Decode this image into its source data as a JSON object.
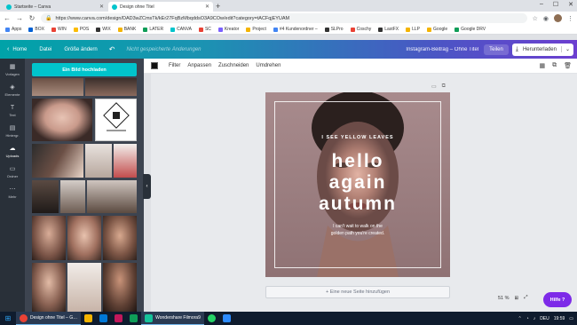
{
  "browser": {
    "tabs": [
      {
        "title": "Startseite – Canva",
        "active": false
      },
      {
        "title": "Design ohne Titel",
        "active": true
      }
    ],
    "new_tab": "+",
    "url": "https://www.canva.com/design/DAD3wZCmsTk/kEr27FqBzMbqddsO3A9COw/edit?category=tACFqjEYUAM",
    "bookmarks": [
      "Apps",
      "BOX",
      "WIN",
      "POS",
      "WIX",
      "BANK",
      "LATER",
      "CANVA",
      "SC",
      "Kreator",
      "Project",
      "#4 Kundenordner –",
      "SLPro",
      "Coschy",
      "LastFX",
      "LLP",
      "Google",
      "Google DRV"
    ]
  },
  "header": {
    "home": "Home",
    "file": "Datei",
    "resize": "Größe ändern",
    "undo_icon": "undo-icon",
    "unsaved": "Nicht gespeicherte Änderungen",
    "doc_title": "Instagram-Beitrag – Ohne Titel",
    "share": "Teilen",
    "download": "Herunterladen"
  },
  "rail": [
    {
      "label": "Vorlagen",
      "icon": "▦"
    },
    {
      "label": "Elemente",
      "icon": "◈"
    },
    {
      "label": "Text",
      "icon": "T"
    },
    {
      "label": "Hintergr.",
      "icon": "▤"
    },
    {
      "label": "Uploads",
      "icon": "☁"
    },
    {
      "label": "Ordner",
      "icon": "▭"
    },
    {
      "label": "Mehr",
      "icon": "⋯"
    }
  ],
  "panel": {
    "upload_button": "Ein Bild hochladen"
  },
  "toolbar": {
    "filter": "Filter",
    "adjust": "Anpassen",
    "crop": "Zuschneiden",
    "flip": "Umdrehen"
  },
  "design": {
    "kicker": "I SEE YELLOW LEAVES",
    "line1": "hello",
    "line2": "again",
    "line3": "autumn",
    "sub1": "I can't wait to walk on the",
    "sub2": "golden path you're created."
  },
  "add_page": "+ Eine neue Seite hinzufügen",
  "zoom": "51 %",
  "help": "Hilfe ?",
  "taskbar": {
    "app1": "Design ohne Titel – G…",
    "app2": "Wondershare Filmora9",
    "lang": "DEU",
    "time": "19:59"
  },
  "colors": {
    "accent": "#00c4cc",
    "header_start": "#00a2a8",
    "header_end": "#6c3fd0",
    "help": "#7d2ae8"
  }
}
